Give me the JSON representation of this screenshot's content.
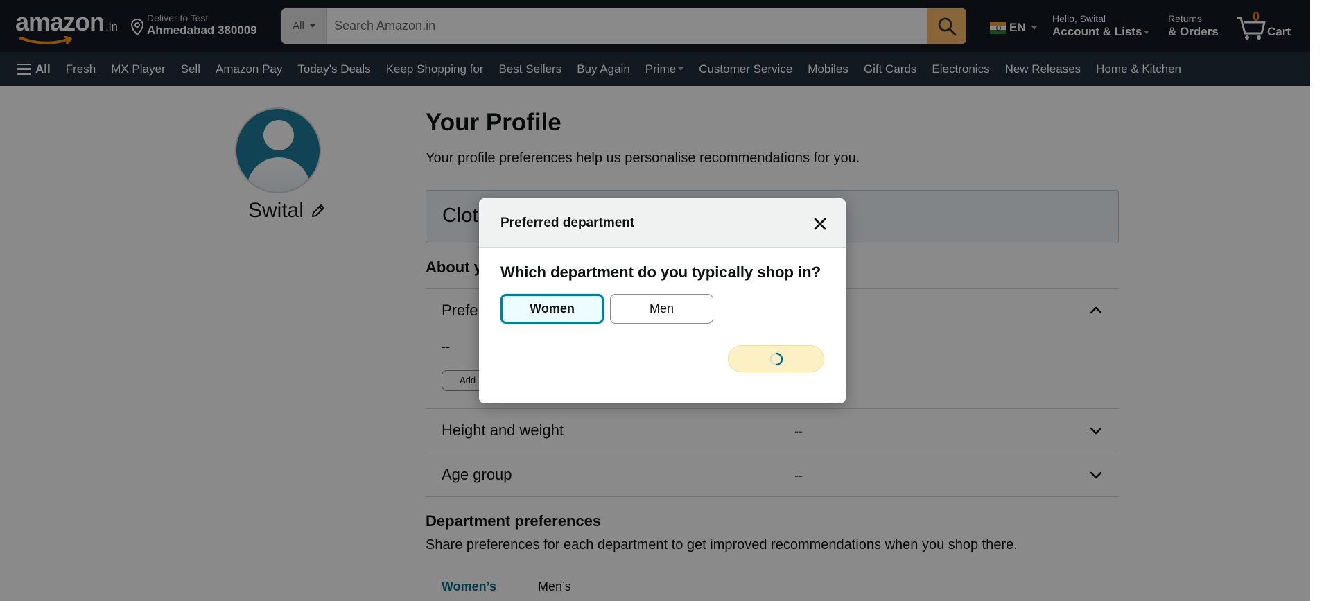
{
  "header": {
    "logo_text": "amazon",
    "logo_tld": ".in",
    "deliver_line1": "Deliver to Test",
    "deliver_line2": "Ahmedabad 380009",
    "search_scope": "All",
    "search_placeholder": "Search Amazon.in",
    "language": "EN",
    "greeting": "Hello, Swital",
    "account_label": "Account & Lists",
    "returns_line1": "Returns",
    "returns_line2": "& Orders",
    "cart_count": "0",
    "cart_label": "Cart"
  },
  "nav": {
    "all_label": "All",
    "links": [
      "Fresh",
      "MX Player",
      "Sell",
      "Amazon Pay",
      "Today's Deals",
      "Keep Shopping for",
      "Best Sellers",
      "Buy Again",
      "Prime",
      "Customer Service",
      "Mobiles",
      "Gift Cards",
      "Electronics",
      "New Releases",
      "Home & Kitchen"
    ]
  },
  "profile": {
    "username": "Swital",
    "title": "Your Profile",
    "subtitle": "Your profile preferences help us personalise recommendations for you.",
    "clothing_box_text": "Clot",
    "about_heading": "About y",
    "pref_row_label": "Prefe",
    "pref_row_value": "--",
    "add_button": "Add",
    "rows": [
      {
        "label": "Height and weight",
        "value": "--"
      },
      {
        "label": "Age group",
        "value": "--"
      }
    ],
    "dept_heading": "Department preferences",
    "dept_sub": "Share preferences for each department to get improved recommendations when you shop there.",
    "tabs": [
      "Women’s",
      "Men’s"
    ]
  },
  "modal": {
    "title": "Preferred department",
    "question": "Which department do you typically shop in?",
    "options": [
      "Women",
      "Men"
    ],
    "selected": "Women"
  },
  "colors": {
    "header_bg": "#131921",
    "subnav_bg": "#232f3e",
    "search_button": "#febd69",
    "accent_teal": "#007185",
    "cart_count": "#f08804"
  }
}
